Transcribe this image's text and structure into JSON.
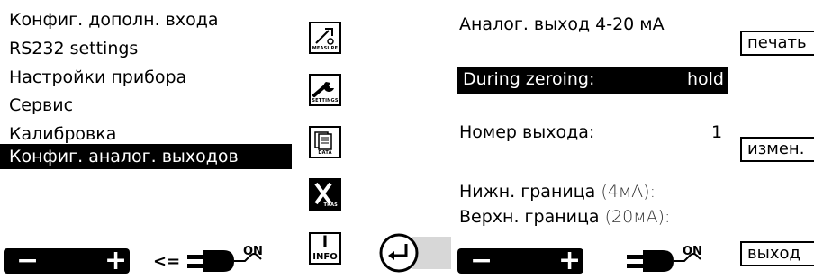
{
  "left": {
    "menu": [
      {
        "label": "Конфиг. дополн. входа"
      },
      {
        "label": "RS232 settings"
      },
      {
        "label": "Настройки прибора"
      },
      {
        "label": "Сервис"
      },
      {
        "label": "Калибровка"
      },
      {
        "label": "Конфиг. аналог. выходов"
      }
    ],
    "icons": {
      "measure": "MEASURE",
      "settings": "SETTINGS",
      "data": "DATA",
      "xtras": "TRAS",
      "info_i": "i",
      "info": "INFO"
    },
    "nav": {
      "minus": "−",
      "plus": "+",
      "arrow": "<=",
      "on": "ON"
    }
  },
  "enter_icon": "enter-icon",
  "right": {
    "title": "Аналог. выход 4-20 мА",
    "during_zeroing_label": "During zeroing:",
    "during_zeroing_value": "hold",
    "output_number_label": "Номер выхода:",
    "output_number_value": "1",
    "lower_bound_label": "Нижн. граница",
    "lower_bound_unit": "(4мА):",
    "upper_bound_label": "Верхн. граница",
    "upper_bound_unit": "(20мА):",
    "buttons": {
      "print": "печать",
      "change": "измен.",
      "exit": "выход"
    },
    "nav": {
      "minus": "−",
      "plus": "+",
      "on": "ON"
    }
  }
}
